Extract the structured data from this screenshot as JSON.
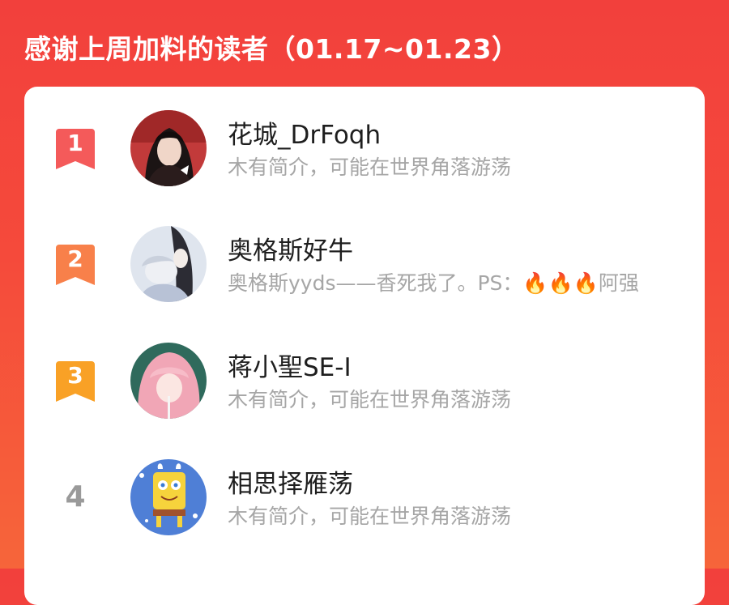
{
  "header": {
    "title": "感谢上周加料的读者（01.17~01.23）"
  },
  "colors": {
    "background_top": "#f2403c",
    "background_bottom": "#f6653a",
    "rank_1": "#f45a5a",
    "rank_2": "#f8804a",
    "rank_3": "#f9a126",
    "rank_plain": "#9a9a9a"
  },
  "readers": [
    {
      "rank": "1",
      "name": "花城_DrFoqh",
      "bio": "木有简介，可能在世界角落游荡",
      "avatar": "avatar-dark-hair-illustration"
    },
    {
      "rank": "2",
      "name": "奥格斯好牛",
      "bio": "奥格斯yyds——香死我了。PS：🔥🔥🔥阿强",
      "avatar": "avatar-couple-illustration"
    },
    {
      "rank": "3",
      "name": "蒋小聖SE-I",
      "bio": "木有简介，可能在世界角落游荡",
      "avatar": "avatar-pink-hair-photo"
    },
    {
      "rank": "4",
      "name": "相思择雁荡",
      "bio": "木有简介，可能在世界角落游荡",
      "avatar": "avatar-spongebob"
    }
  ]
}
